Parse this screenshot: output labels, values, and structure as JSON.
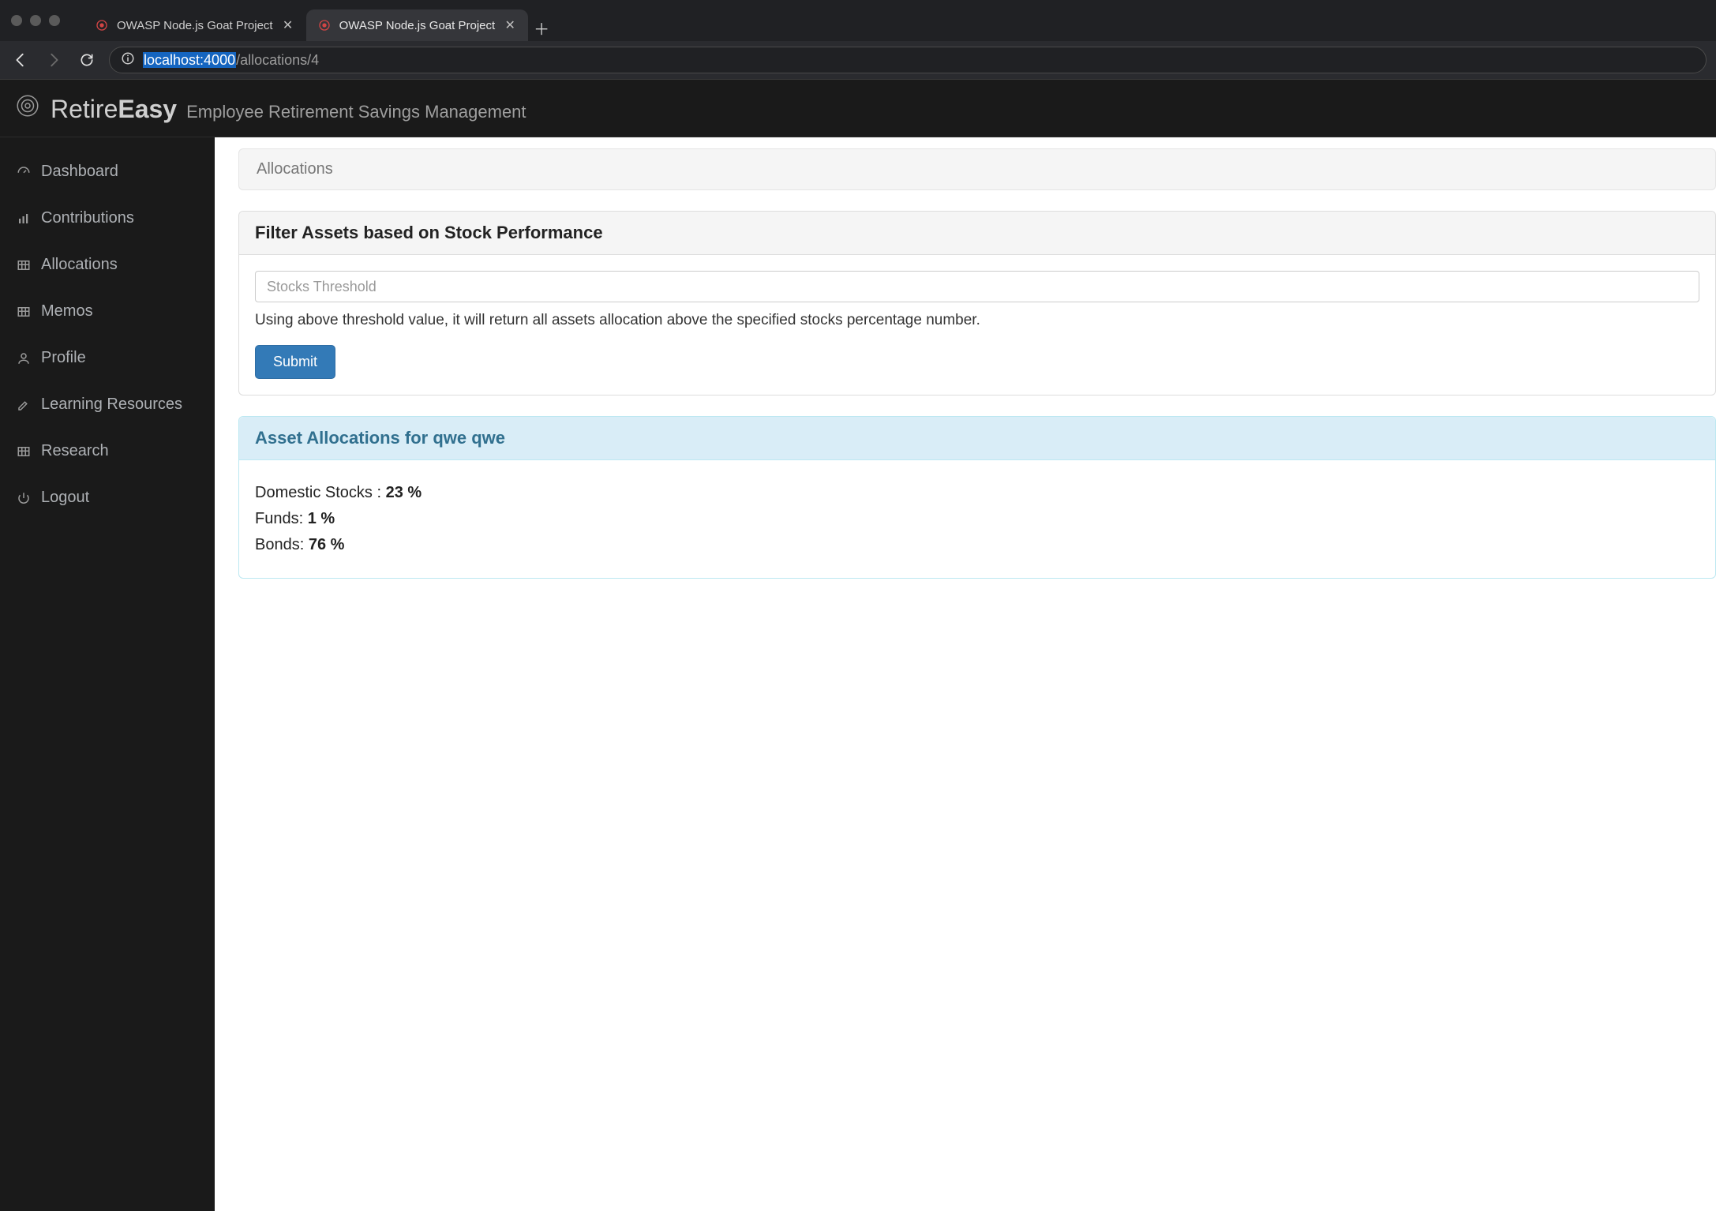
{
  "browser": {
    "tabs": [
      {
        "title": "OWASP Node.js Goat Project",
        "active": false
      },
      {
        "title": "OWASP Node.js Goat Project",
        "active": true
      }
    ],
    "url_host": "localhost:4000",
    "url_path": "/allocations/4"
  },
  "header": {
    "brand_prefix": "Retire",
    "brand_bold": "Easy",
    "subtitle": "Employee Retirement Savings Management"
  },
  "sidebar": {
    "items": [
      {
        "icon": "dashboard-icon",
        "label": "Dashboard"
      },
      {
        "icon": "bar-chart-icon",
        "label": "Contributions"
      },
      {
        "icon": "table-icon",
        "label": "Allocations"
      },
      {
        "icon": "table-icon",
        "label": "Memos"
      },
      {
        "icon": "user-icon",
        "label": "Profile"
      },
      {
        "icon": "edit-icon",
        "label": "Learning Resources"
      },
      {
        "icon": "table-icon",
        "label": "Research"
      },
      {
        "icon": "power-icon",
        "label": "Logout"
      }
    ]
  },
  "breadcrumb": {
    "current": "Allocations"
  },
  "filter_panel": {
    "title": "Filter Assets based on Stock Performance",
    "input_placeholder": "Stocks Threshold",
    "help": "Using above threshold value, it will return all assets allocation above the specified stocks percentage number.",
    "submit_label": "Submit"
  },
  "alloc_panel": {
    "title": "Asset Allocations for qwe qwe",
    "rows": [
      {
        "label": "Domestic Stocks : ",
        "value": "23 %"
      },
      {
        "label": "Funds: ",
        "value": "1 %"
      },
      {
        "label": "Bonds: ",
        "value": "76 %"
      }
    ]
  }
}
